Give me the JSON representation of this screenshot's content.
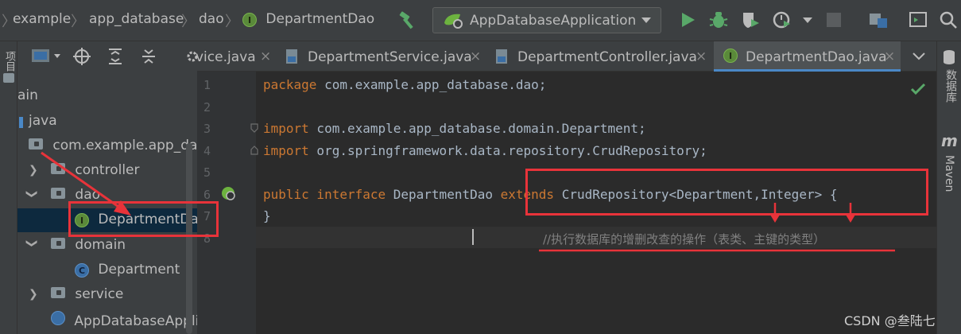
{
  "breadcrumbs": [
    "example",
    "app_database",
    "dao",
    "DepartmentDao"
  ],
  "run_config": {
    "label": "AppDatabaseApplication"
  },
  "left_strip": {
    "label": "项目"
  },
  "project_tree": {
    "items": [
      {
        "label": "ain"
      },
      {
        "label": "java"
      },
      {
        "label": "com.example.app_data"
      },
      {
        "label": "controller"
      },
      {
        "label": "dao"
      },
      {
        "label": "DepartmentDao"
      },
      {
        "label": "domain"
      },
      {
        "label": "Department"
      },
      {
        "label": "service"
      },
      {
        "label": "AppDatabaseApplic"
      }
    ]
  },
  "tabs": [
    {
      "label": "vice.java"
    },
    {
      "label": "DepartmentService.java"
    },
    {
      "label": "DepartmentController.java"
    },
    {
      "label": "DepartmentDao.java"
    }
  ],
  "tab_close_glyph": "×",
  "editor": {
    "line_numbers": [
      "1",
      "2",
      "3",
      "4",
      "5",
      "6",
      "7",
      "8"
    ],
    "lines": {
      "l1_kw": "package",
      "l1_rest": " com.example.app_database.dao;",
      "l3_kw": "import",
      "l3_rest": " com.example.app_database.domain.Department;",
      "l4_kw": "import",
      "l4_rest": " org.springframework.data.repository.CrudRepository;",
      "l6_kw1": "public interface",
      "l6_name": " DepartmentDao ",
      "l6_kw2": "extends",
      "l6_rest": " CrudRepository<Department,Integer> {",
      "l7": "}",
      "l8_comment": "//执行数据库的增删改查的操作（表类、主键的类型）"
    }
  },
  "right_strip": {
    "database_label": "数据库",
    "maven_label": "Maven",
    "maven_glyph": "m"
  },
  "watermark": "CSDN @叁陆七",
  "colors": {
    "keyword": "#cc7832",
    "comment": "#808080",
    "annotation_red": "#e8333a",
    "interface_green": "#5a8a3a",
    "selection_blue": "#0d293e"
  }
}
